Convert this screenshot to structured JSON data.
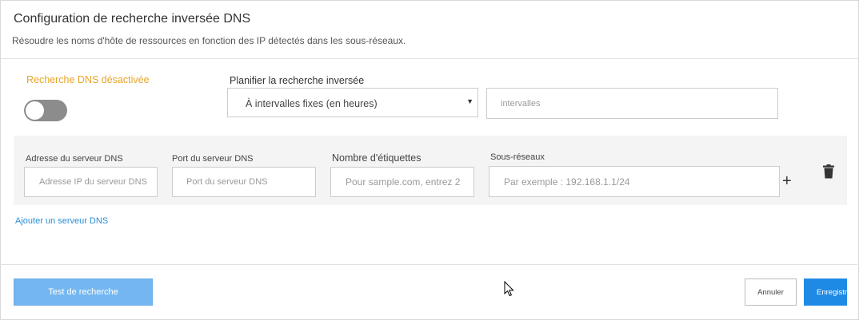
{
  "header": {
    "title": "Configuration de recherche inversée DNS",
    "subtitle": "Résoudre les noms d'hôte de ressources en fonction des IP détectés dans les sous-réseaux."
  },
  "dns_lookup": {
    "status_label": "Recherche DNS désactivée",
    "enabled": false,
    "status_color": "#e8a52a"
  },
  "schedule": {
    "label": "Planifier la recherche inversée",
    "selected_option": "À intervalles fixes (en heures)",
    "interval_placeholder": "intervalles",
    "interval_value": ""
  },
  "dns_server": {
    "address_label": "Adresse du serveur DNS",
    "address_placeholder": "Adresse IP du serveur DNS",
    "port_label": "Port du serveur DNS",
    "port_placeholder": "Port du serveur DNS",
    "labels_count_label": "Nombre d'étiquettes",
    "labels_count_placeholder": "Pour sample.com, entrez 2",
    "subnets_label": "Sous-réseaux",
    "subnets_placeholder": "Par exemple : 192.168.1.1/24",
    "add_icon": "+"
  },
  "add_server_link": "Ajouter un serveur DNS",
  "footer": {
    "test_button": "Test de recherche",
    "cancel_button": "Annuler",
    "save_button": "Enregistrer"
  },
  "colors": {
    "accent": "#1f8ae6",
    "link": "#2a8fd6",
    "test_button": "#74b7f0"
  }
}
